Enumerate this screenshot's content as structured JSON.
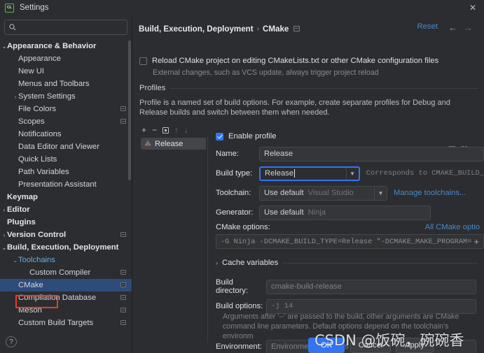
{
  "window": {
    "title": "Settings",
    "app_icon": "clion-icon",
    "close_label": "✕"
  },
  "search": {
    "placeholder": "",
    "value": "",
    "icon": "search-icon"
  },
  "sidebar": {
    "items": [
      {
        "label": "Appearance & Behavior",
        "indent": 0,
        "arrow": "⌄",
        "bold": true,
        "badge": false,
        "selected": false,
        "link": false
      },
      {
        "label": "Appearance",
        "indent": 1,
        "arrow": "",
        "bold": false,
        "badge": false,
        "selected": false,
        "link": false
      },
      {
        "label": "New UI",
        "indent": 1,
        "arrow": "",
        "bold": false,
        "badge": false,
        "selected": false,
        "link": false
      },
      {
        "label": "Menus and Toolbars",
        "indent": 1,
        "arrow": "",
        "bold": false,
        "badge": false,
        "selected": false,
        "link": false
      },
      {
        "label": "System Settings",
        "indent": 1,
        "arrow": "›",
        "bold": false,
        "badge": false,
        "selected": false,
        "link": false
      },
      {
        "label": "File Colors",
        "indent": 1,
        "arrow": "",
        "bold": false,
        "badge": true,
        "selected": false,
        "link": false
      },
      {
        "label": "Scopes",
        "indent": 1,
        "arrow": "",
        "bold": false,
        "badge": true,
        "selected": false,
        "link": false
      },
      {
        "label": "Notifications",
        "indent": 1,
        "arrow": "",
        "bold": false,
        "badge": false,
        "selected": false,
        "link": false
      },
      {
        "label": "Data Editor and Viewer",
        "indent": 1,
        "arrow": "",
        "bold": false,
        "badge": false,
        "selected": false,
        "link": false
      },
      {
        "label": "Quick Lists",
        "indent": 1,
        "arrow": "",
        "bold": false,
        "badge": false,
        "selected": false,
        "link": false
      },
      {
        "label": "Path Variables",
        "indent": 1,
        "arrow": "",
        "bold": false,
        "badge": false,
        "selected": false,
        "link": false
      },
      {
        "label": "Presentation Assistant",
        "indent": 1,
        "arrow": "",
        "bold": false,
        "badge": false,
        "selected": false,
        "link": false
      },
      {
        "label": "Keymap",
        "indent": 0,
        "arrow": "",
        "bold": true,
        "badge": false,
        "selected": false,
        "link": false
      },
      {
        "label": "Editor",
        "indent": 0,
        "arrow": "›",
        "bold": true,
        "badge": false,
        "selected": false,
        "link": false
      },
      {
        "label": "Plugins",
        "indent": 0,
        "arrow": "",
        "bold": true,
        "badge": false,
        "selected": false,
        "link": false
      },
      {
        "label": "Version Control",
        "indent": 0,
        "arrow": "›",
        "bold": true,
        "badge": true,
        "selected": false,
        "link": false
      },
      {
        "label": "Build, Execution, Deployment",
        "indent": 0,
        "arrow": "⌄",
        "bold": true,
        "badge": false,
        "selected": false,
        "link": false
      },
      {
        "label": "Toolchains",
        "indent": 1,
        "arrow": "⌄",
        "bold": false,
        "badge": false,
        "selected": false,
        "link": true
      },
      {
        "label": "Custom Compiler",
        "indent": 2,
        "arrow": "",
        "bold": false,
        "badge": true,
        "selected": false,
        "link": false
      },
      {
        "label": "CMake",
        "indent": 1,
        "arrow": "",
        "bold": false,
        "badge": true,
        "selected": true,
        "link": false
      },
      {
        "label": "Compilation Database",
        "indent": 1,
        "arrow": "",
        "bold": false,
        "badge": true,
        "selected": false,
        "link": false
      },
      {
        "label": "Meson",
        "indent": 1,
        "arrow": "",
        "bold": false,
        "badge": true,
        "selected": false,
        "link": false
      },
      {
        "label": "Custom Build Targets",
        "indent": 1,
        "arrow": "",
        "bold": false,
        "badge": true,
        "selected": false,
        "link": false
      }
    ],
    "help_label": "?"
  },
  "main": {
    "breadcrumb_parent": "Build, Execution, Deployment",
    "breadcrumb_sep": "›",
    "breadcrumb_current": "CMake",
    "reset_label": "Reset",
    "nav_back": "←",
    "nav_forward": "→",
    "reload_checkbox_label": "Reload CMake project on editing CMakeLists.txt or other CMake configuration files",
    "reload_checkbox_checked": false,
    "reload_sub_label": "External changes, such as VCS update, always trigger project reload",
    "profiles_title": "Profiles",
    "profiles_description": "Profile is a named set of build options. For example, create separate profiles for Debug and Release builds and switch between them when needed.",
    "toolbar": {
      "add": "+",
      "remove": "−",
      "copy": "copy-icon",
      "move_up": "↑",
      "move_down": "↓"
    },
    "profile_list": [
      {
        "name": "Release",
        "icon": "cmake-profile-icon",
        "selected": true
      }
    ],
    "enable_profile_label": "Enable profile",
    "enable_profile_checked": true,
    "share_label": "Share",
    "share_checked": false,
    "fields": {
      "name_label": "Name:",
      "name_value": "Release",
      "build_type_label": "Build type:",
      "build_type_value": "Release",
      "build_type_hint": "Corresponds to CMAKE_BUILD_",
      "toolchain_label": "Toolchain:",
      "toolchain_value": "Use default",
      "toolchain_gray": "Visual Studio",
      "manage_toolchains_link": "Manage toolchains...",
      "generator_label": "Generator:",
      "generator_value": "Use default",
      "generator_gray": "Ninja",
      "cmake_options_label": "CMake options:",
      "all_cmake_options_link": "All CMake optio",
      "cmake_options_value": "-G Ninja -DCMAKE_BUILD_TYPE=Release \"-DCMAKE_MAKE_PROGRAM=C:/MySof",
      "cmake_options_expand": "+",
      "cache_variables_label": "Cache variables",
      "cache_variables_arrow": "›",
      "build_directory_label": "Build directory:",
      "build_directory_value": "cmake-build-release",
      "build_options_label": "Build options:",
      "build_options_value": "-j 14",
      "build_options_hint": "Arguments after '--' are passed to the build, other arguments are CMake command line parameters. Default options depend on the toolchain's environm",
      "environment_label": "Environment:",
      "environment_placeholder": "Environment variables"
    },
    "buttons": {
      "ok": "OK",
      "cancel": "Cancel",
      "apply": "Apply"
    }
  },
  "watermark": "CSDN @饭碗，碗碗香",
  "colors": {
    "accent": "#3574f0",
    "link": "#4a88c7",
    "selection": "#2e4b7a",
    "annotation": "#e83b2d",
    "background": "#2b2d30"
  }
}
